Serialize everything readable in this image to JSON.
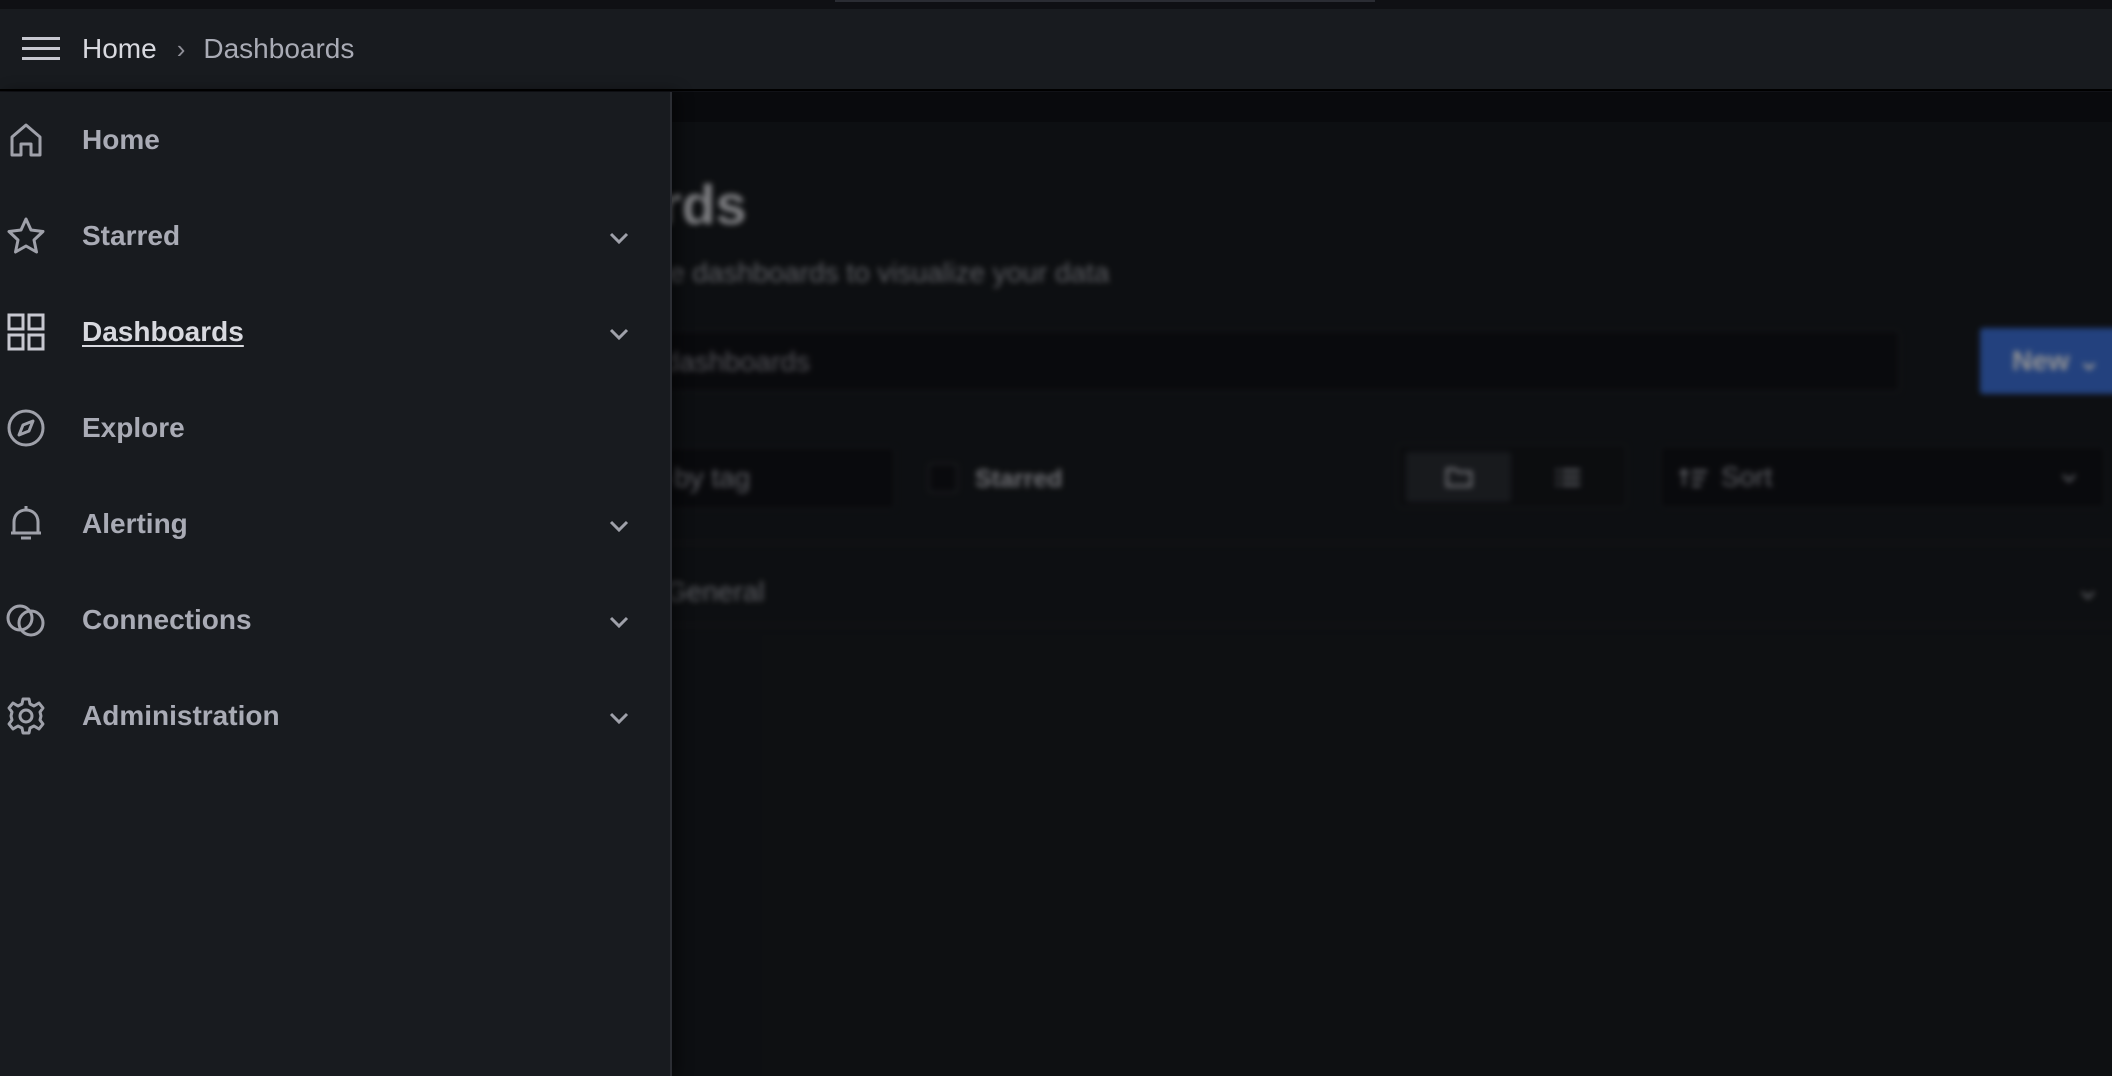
{
  "breadcrumb": {
    "home": "Home",
    "separator": "›",
    "current": "Dashboards"
  },
  "sidebar": {
    "items": [
      {
        "label": "Home",
        "icon": "home-icon",
        "expandable": false,
        "active": false
      },
      {
        "label": "Starred",
        "icon": "star-icon",
        "expandable": true,
        "active": false
      },
      {
        "label": "Dashboards",
        "icon": "apps-icon",
        "expandable": true,
        "active": true
      },
      {
        "label": "Explore",
        "icon": "compass-icon",
        "expandable": false,
        "active": false
      },
      {
        "label": "Alerting",
        "icon": "bell-icon",
        "expandable": true,
        "active": false
      },
      {
        "label": "Connections",
        "icon": "connections-icon",
        "expandable": true,
        "active": false
      },
      {
        "label": "Administration",
        "icon": "gear-icon",
        "expandable": true,
        "active": false
      }
    ]
  },
  "main": {
    "title": "boards",
    "subtitle": "d manage dashboards to visualize your data",
    "search_placeholder": "or dashboards",
    "new_button": "New",
    "tag_filter": "by tag",
    "starred_label": "Starred",
    "sort_label": "Sort",
    "folder": "General"
  },
  "colors": {
    "background": "#111217",
    "panel": "#181b1f",
    "primary": "#3d71d9",
    "text": "#ccccdc"
  }
}
